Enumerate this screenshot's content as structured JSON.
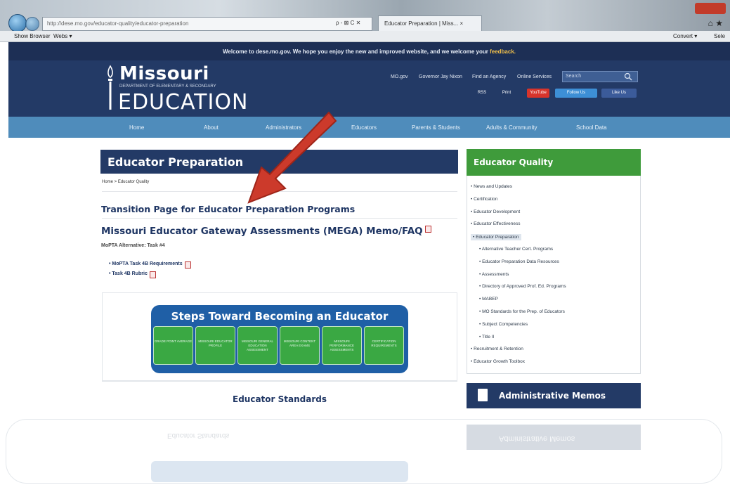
{
  "browser": {
    "address": "http://dese.mo.gov/educator-quality/educator-preparation",
    "address_ctrls": "ρ - ⊠ C ✕",
    "tab_label": "Educator Preparation | Miss... ×",
    "fav_show_browser": "Show Browser",
    "fav_webs": "Webs ▾",
    "fav_convert": "Convert ▾",
    "fav_select": "Sele"
  },
  "site": {
    "welcome_text": "Welcome to dese.mo.gov. We hope you enjoy the new and improved website, and we welcome your",
    "welcome_link": "feedback.",
    "logo_missouri": "Missouri",
    "logo_dept": "DEPARTMENT OF ELEMENTARY & SECONDARY",
    "logo_education": "EDUCATION",
    "top_links": [
      "MO.gov",
      "Governor Jay Nixon",
      "Find an Agency",
      "Online Services"
    ],
    "search_placeholder": "Search",
    "social": [
      "RSS",
      "Print",
      "YouTube",
      "Follow Us",
      "Like Us"
    ],
    "nav": [
      "Home",
      "About",
      "Administrators",
      "Educators",
      "Parents & Students",
      "Adults & Community",
      "School Data"
    ]
  },
  "main": {
    "page_title": "Educator Preparation",
    "breadcrumb": "Home > Educator Quality",
    "transition_link": "Transition Page for Educator Preparation Programs",
    "mega_title": "Missouri Educator Gateway Assessments (MEGA) Memo/FAQ",
    "mopta_alt": "MoPTA Alternative: Task #4",
    "bullets": [
      "MoPTA Task 4B Requirements",
      "Task 4B Rubric"
    ],
    "steps_title": "Steps Toward Becoming an Educator",
    "steps": [
      "GRADE POINT AVERAGE",
      "MISSOURI EDUCATOR PROFILE",
      "MISSOURI GENERAL EDUCATION ASSESSMENT",
      "MISSOURI CONTENT AREA EXAMS",
      "MISSOURI PERFORMANCE ASSESSMENTS",
      "CERTIFICATION REQUIREMENTS"
    ],
    "standards_title": "Educator Standards"
  },
  "sidebar": {
    "heading": "Educator Quality",
    "items": [
      {
        "label": "News and Updates",
        "level": 0
      },
      {
        "label": "Certification",
        "level": 0
      },
      {
        "label": "Educator Development",
        "level": 0
      },
      {
        "label": "Educator Effectiveness",
        "level": 0
      },
      {
        "label": "Educator Preparation",
        "level": 0,
        "active": true
      },
      {
        "label": "Alternative Teacher Cert. Programs",
        "level": 1
      },
      {
        "label": "Educator Preparation Data Resources",
        "level": 1
      },
      {
        "label": "Assessments",
        "level": 1
      },
      {
        "label": "Directory of Approved Prof. Ed. Programs",
        "level": 1
      },
      {
        "label": "MABEP",
        "level": 1
      },
      {
        "label": "MO Standards for the Prep. of Educators",
        "level": 1
      },
      {
        "label": "Subject Competencies",
        "level": 1
      },
      {
        "label": "Title II",
        "level": 1
      },
      {
        "label": "Recruitment & Retention",
        "level": 0
      },
      {
        "label": "Educator Growth Toolbox",
        "level": 0
      }
    ],
    "admin_memos": "Administrative Memos"
  },
  "colors": {
    "navy": "#233a66",
    "nav_blue": "#4f8cbb",
    "green": "#3f9b3b",
    "arrow_red": "#cc3a2b"
  }
}
